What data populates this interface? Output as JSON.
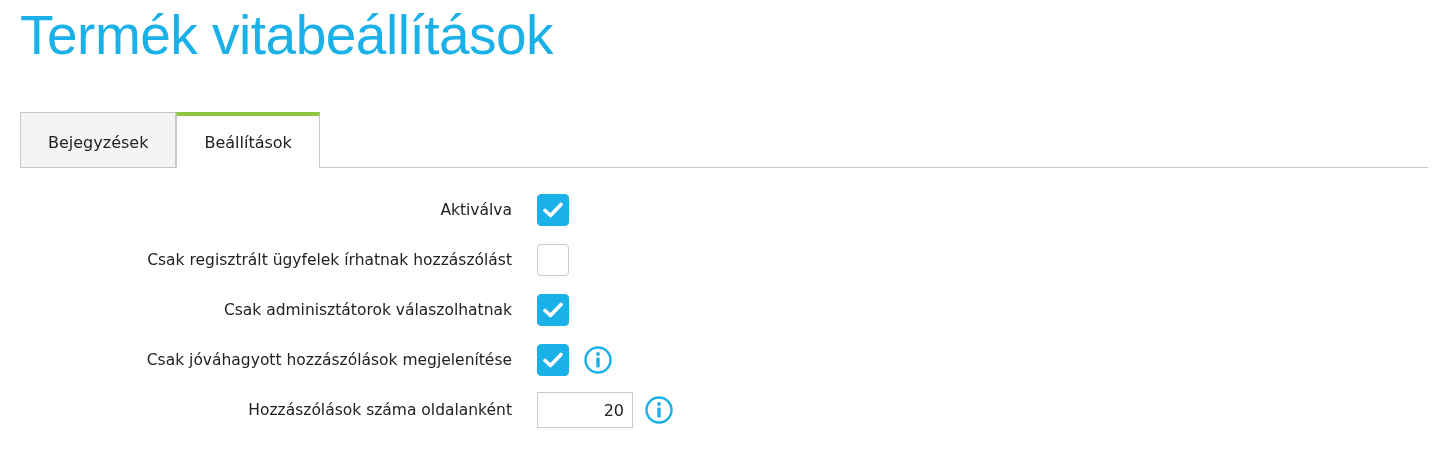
{
  "title": "Termék vitabeállítások",
  "tabs": [
    {
      "label": "Bejegyzések",
      "selected": false
    },
    {
      "label": "Beállítások",
      "selected": true
    }
  ],
  "settings": [
    {
      "kind": "checkbox",
      "label": "Aktiválva",
      "checked": true,
      "info": false
    },
    {
      "kind": "checkbox",
      "label": "Csak regisztrált ügyfelek írhatnak hozzászólást",
      "checked": false,
      "info": false
    },
    {
      "kind": "checkbox",
      "label": "Csak adminisztátorok válaszolhatnak",
      "checked": true,
      "info": false
    },
    {
      "kind": "checkbox",
      "label": "Csak jóváhagyott hozzászólások megjelenítése",
      "checked": true,
      "info": true
    },
    {
      "kind": "number",
      "label": "Hozzászólások száma oldalanként",
      "value": "20",
      "info": true
    }
  ]
}
